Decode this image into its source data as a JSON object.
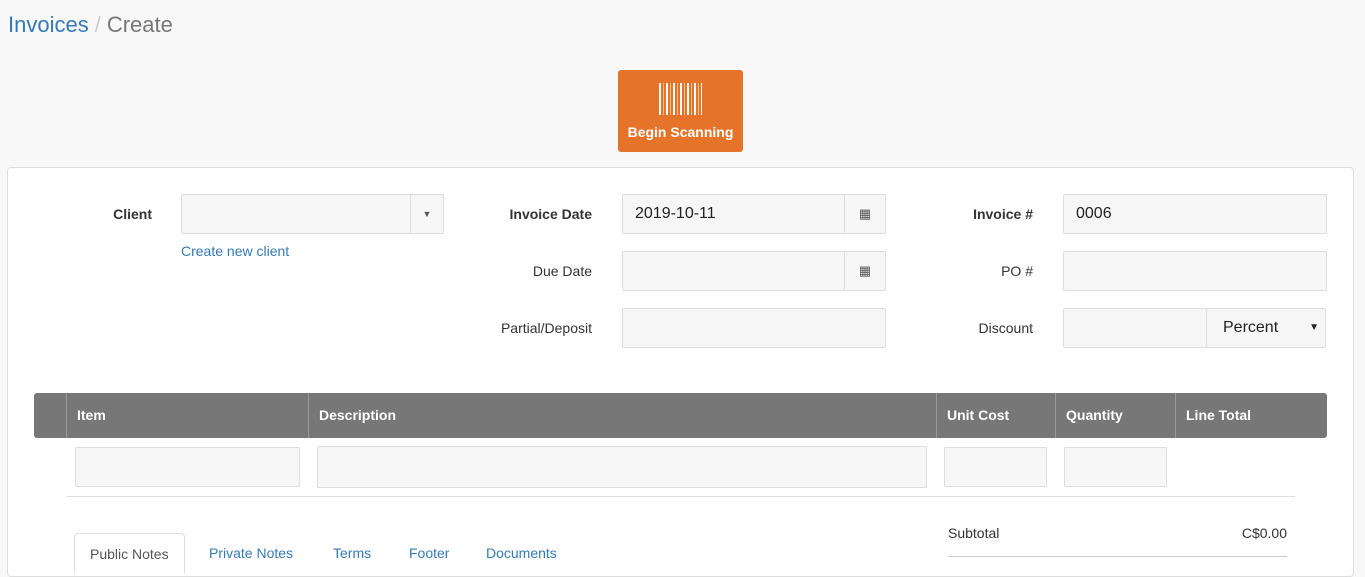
{
  "breadcrumb": {
    "parent": "Invoices",
    "separator": "/",
    "current": "Create"
  },
  "scan_button": {
    "label": "Begin Scanning",
    "icon": "barcode-icon",
    "color": "#e5742a"
  },
  "form": {
    "client_label": "Client",
    "client_value": "",
    "create_client_link": "Create new client",
    "invoice_date_label": "Invoice Date",
    "invoice_date_value": "2019-10-11",
    "due_date_label": "Due Date",
    "due_date_value": "",
    "partial_label": "Partial/Deposit",
    "partial_value": "",
    "invoice_number_label": "Invoice #",
    "invoice_number_value": "0006",
    "po_label": "PO #",
    "po_value": "",
    "discount_label": "Discount",
    "discount_value": "",
    "discount_type": "Percent"
  },
  "table": {
    "headers": [
      "Item",
      "Description",
      "Unit Cost",
      "Quantity",
      "Line Total"
    ]
  },
  "totals": {
    "subtotal_label": "Subtotal",
    "subtotal_value": "C$0.00"
  },
  "tabs": [
    "Public Notes",
    "Private Notes",
    "Terms",
    "Footer",
    "Documents"
  ]
}
